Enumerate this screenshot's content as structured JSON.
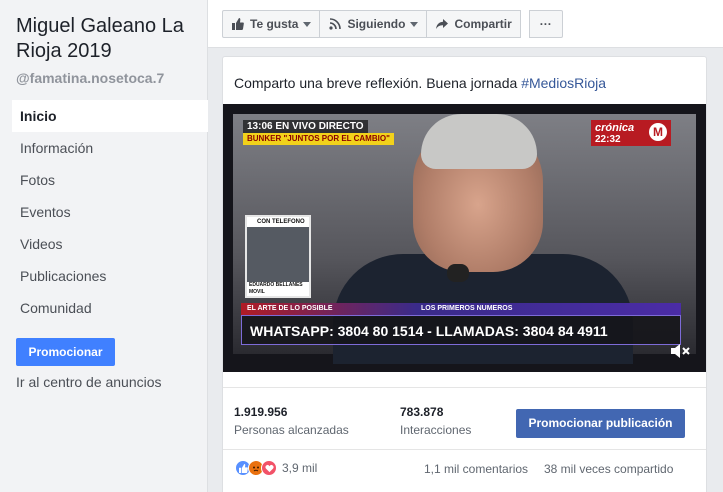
{
  "sidebar": {
    "page_name": "Miguel Galeano La Rioja 2019",
    "handle": "@famatina.nosetoca.7",
    "items": [
      {
        "label": "Inicio"
      },
      {
        "label": "Información"
      },
      {
        "label": "Fotos"
      },
      {
        "label": "Eventos"
      },
      {
        "label": "Videos"
      },
      {
        "label": "Publicaciones"
      },
      {
        "label": "Comunidad"
      }
    ],
    "promote_label": "Promocionar",
    "ads_link": "Ir al centro de anuncios"
  },
  "actions": {
    "like_label": "Te gusta",
    "follow_label": "Siguiendo",
    "share_label": "Compartir",
    "more_label": "···"
  },
  "post": {
    "text": "Comparto una breve reflexión. Buena jornada ",
    "hashtag": "#MediosRioja",
    "video": {
      "live_top": "13:06  EN VIVO  DIRECTO",
      "live_sub": "BUNKER \"JUNTOS POR EL CAMBIO\"",
      "channel": "crónica",
      "time": "22:32",
      "inset_head": "CON TELEFONO",
      "inset_caption": "EDUARDO BELLANES\nMOVIL",
      "ticker_left": "EL ARTE DE LO POSIBLE",
      "ticker_right": "LOS PRIMEROS NUMEROS",
      "ticker_main": "WHATSAPP: 3804 80 1514 - LLAMADAS: 3804 84 4911"
    },
    "reach_value": "1.919.956",
    "reach_label": "Personas alcanzadas",
    "interactions_value": "783.878",
    "interactions_label": "Interacciones",
    "boost_label": "Promocionar publicación",
    "reactions_count": "3,9 mil",
    "comments": "1,1 mil comentarios",
    "shares": "38 mil veces compartido"
  },
  "colors": {
    "accent": "#4267b2",
    "promote": "#4080ff",
    "hashtag": "#365899"
  }
}
